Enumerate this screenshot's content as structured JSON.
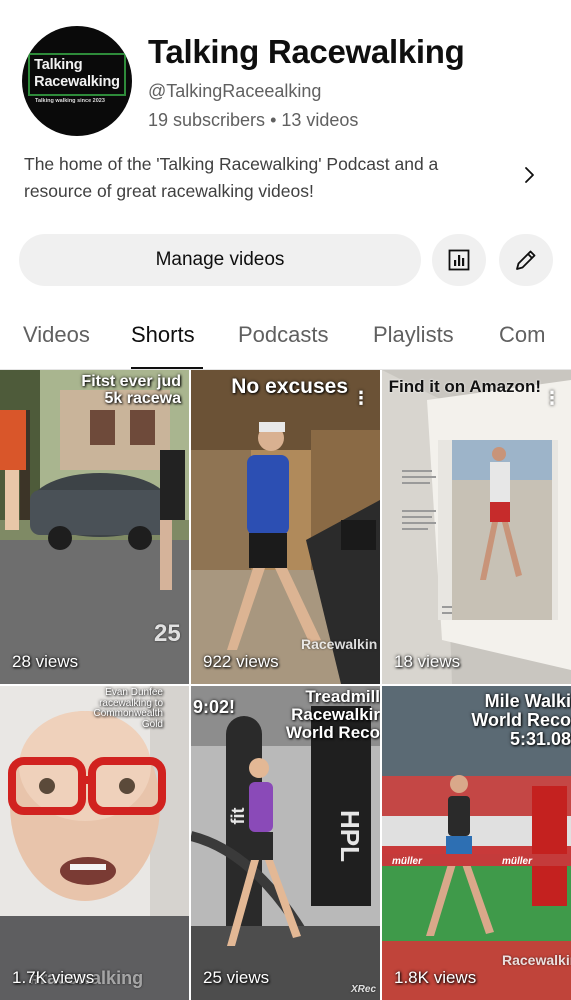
{
  "channel": {
    "avatar_line1": "Talking",
    "avatar_line2": "Racewalking",
    "avatar_tagline": "Talking walking since 2023",
    "name": "Talking Racewalking",
    "handle": "@TalkingRaceealking",
    "subscribers": "19 subscribers",
    "separator": "•",
    "videos": "13 videos",
    "description": "The home of the 'Talking Racewalking' Podcast and a resource of great racewalking videos!"
  },
  "actions": {
    "manage_label": "Manage videos",
    "stats_icon": "analytics-icon",
    "edit_icon": "pencil-icon"
  },
  "tabs": [
    {
      "label": "Videos"
    },
    {
      "label": "Shorts",
      "active": true
    },
    {
      "label": "Podcasts"
    },
    {
      "label": "Playlists"
    },
    {
      "label": "Com"
    }
  ],
  "shorts": [
    {
      "title_line1": "Fitst ever jud",
      "title_line2": "5k racewa",
      "overlay": "25",
      "views": "28 views"
    },
    {
      "title": "No excuses",
      "overlay": "Racewalkin",
      "views": "922 views"
    },
    {
      "title": "Find it on Amazon!",
      "views": "18 views"
    },
    {
      "title_line1": "Evan Dunfee",
      "title_line2": "racewalking to",
      "title_line3": "Commonwealth",
      "title_line4": "Gold",
      "overlay": "#racewalking",
      "views": "1.7K views"
    },
    {
      "title": "9:02!",
      "overlay": "XRec",
      "views": "25 views"
    },
    {
      "title_line1": "Mile Walki",
      "title_line2": "World Reco",
      "title_line3": "5:31.08",
      "overlay": "Racewalkin",
      "views": "1.8K views"
    }
  ],
  "treadmill": {
    "title_line1": "Treadmill",
    "title_line2": "Racewalkir",
    "title_line3": "World Reco"
  },
  "colors": {
    "accent": "#0f0f0f",
    "secondary_text": "#606060",
    "button_bg": "#f0f0f0",
    "avatar_border": "#2e8b3a"
  }
}
